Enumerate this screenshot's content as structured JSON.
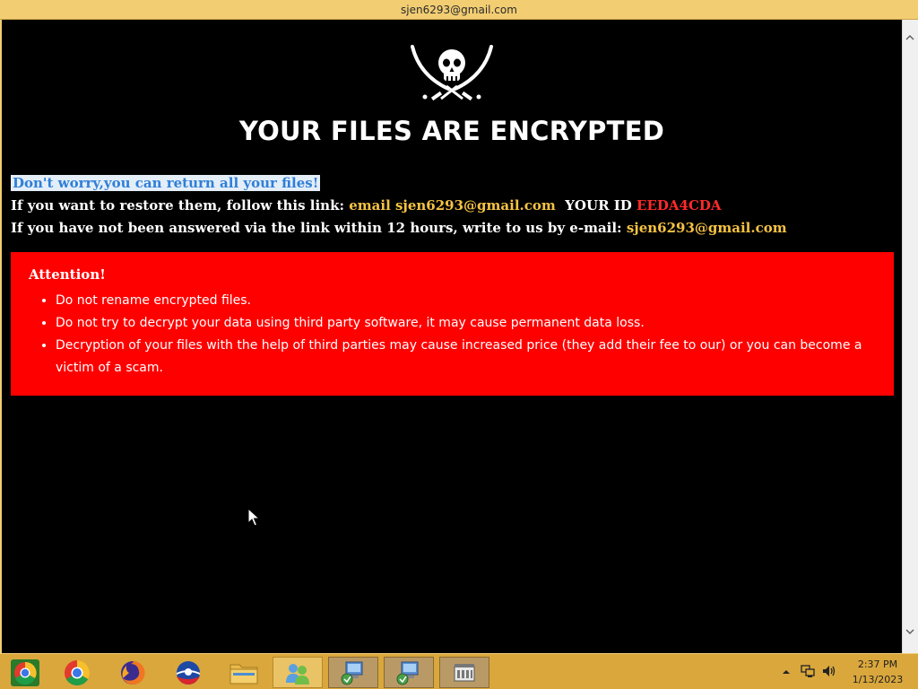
{
  "window": {
    "title": "sjen6293@gmail.com"
  },
  "note": {
    "headline": "YOUR FILES ARE ENCRYPTED",
    "line1": "Don't worry,you can return all your files!",
    "line2_prefix": "If you want to restore them, follow this link: ",
    "line2_link": "email sjen6293@gmail.com",
    "line2_id_label": "YOUR ID ",
    "line2_id_value": "EEDA4CDA",
    "line3_prefix": "If you have not been answered via the link within 12 hours, write to us by e-mail: ",
    "line3_email": "sjen6293@gmail.com",
    "attention": {
      "title": "Attention!",
      "items": [
        "Do not rename encrypted files.",
        "Do not try to decrypt your data using third party software, it may cause permanent data loss.",
        "Decryption of your files with the help of third parties may cause increased price (they add their fee to our) or you can become a victim of a scam."
      ]
    }
  },
  "taskbar": {
    "apps": [
      "chrome-alt-icon",
      "chrome-icon",
      "firefox-icon",
      "opera-icon",
      "file-explorer-icon",
      "people-icon",
      "network-install-icon",
      "network-install-icon-2",
      "server-icon"
    ],
    "time": "2:37 PM",
    "date": "1/13/2023"
  },
  "colors": {
    "background": "#000000",
    "alert_box": "#ff0000",
    "highlight_text": "#f6c343",
    "id_text": "#ff2a2a",
    "titlebar": "#f2cd72",
    "taskbar": "#d9a73c"
  }
}
